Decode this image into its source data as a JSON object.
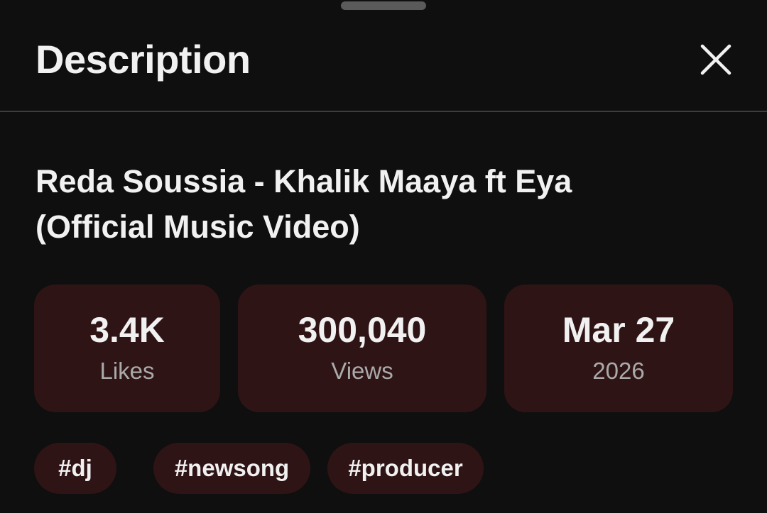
{
  "header": {
    "title": "Description",
    "close_icon": "close-icon"
  },
  "video": {
    "title_line1": "Reda Soussia - Khalik Maaya ft Eya",
    "title_line2": "(Official Music Video)"
  },
  "stats": [
    {
      "value": "3.4K",
      "label": "Likes"
    },
    {
      "value": "300,040",
      "label": "Views"
    },
    {
      "value": "Mar 27",
      "label": "2026"
    }
  ],
  "tags": [
    "#dj",
    "#newsong",
    "#producer"
  ],
  "colors": {
    "background": "#0f0f0f",
    "card": "#2f1416",
    "text_primary": "#f1f1f1",
    "text_secondary": "#aaaaaa",
    "divider": "#3d3d3d"
  }
}
